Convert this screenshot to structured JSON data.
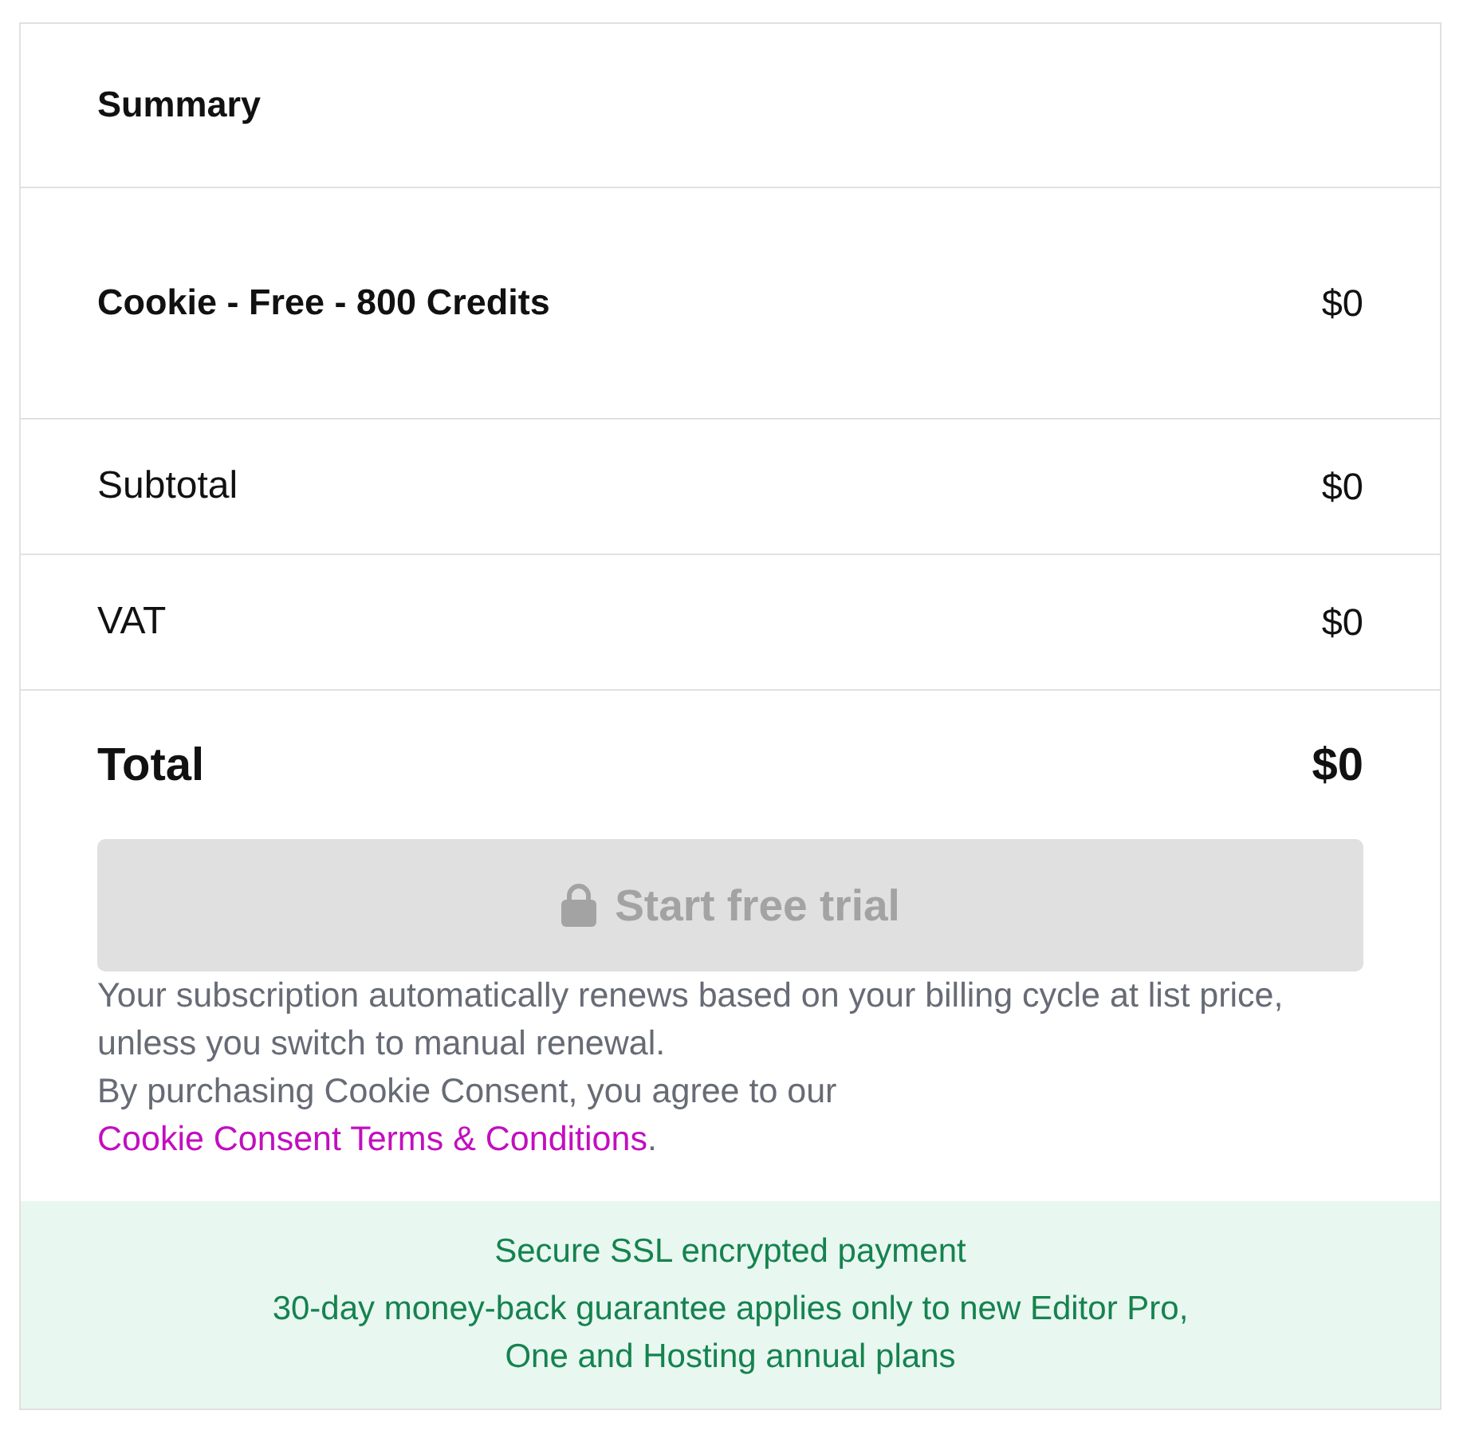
{
  "summary": {
    "title": "Summary"
  },
  "line_items": [
    {
      "kind": "product",
      "label": "Cookie - Free - 800 Credits",
      "amount": "$0"
    },
    {
      "kind": "subtotal",
      "label": "Subtotal",
      "amount": "$0"
    },
    {
      "kind": "tax",
      "label": "VAT",
      "amount": "$0"
    }
  ],
  "total": {
    "label": "Total",
    "amount": "$0"
  },
  "checkout_button": {
    "label": "Start free trial",
    "disabled": true
  },
  "renewal_note": "Your subscription automatically renews based on your billing cycle at list price, unless you switch to manual renewal.",
  "terms_note": {
    "text": "By purchasing Cookie Consent, you agree to our ",
    "link": "Cookie Consent Terms & Conditions",
    "end": "."
  },
  "guarantee": {
    "lines": [
      "Secure SSL encrypted payment",
      "30-day money-back guarantee applies only to new Editor Pro, One and Hosting annual plans"
    ]
  }
}
